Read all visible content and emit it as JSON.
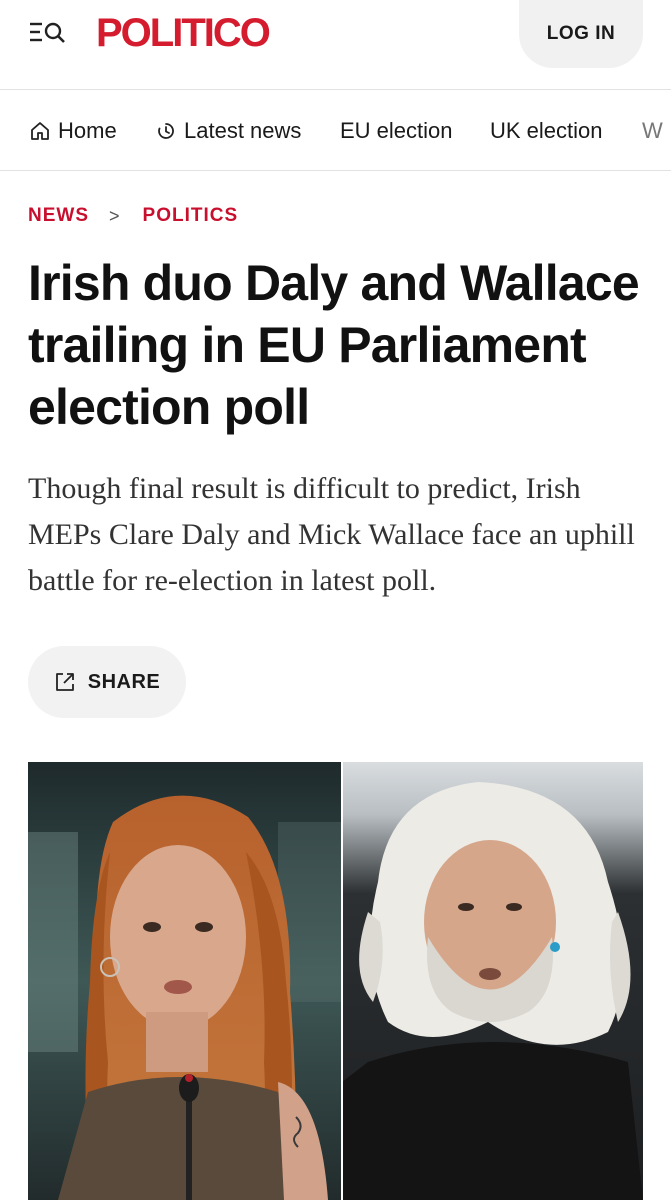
{
  "header": {
    "logo": "POLITICO",
    "login_label": "LOG IN",
    "menu_icon": "menu-search-icon",
    "brand_color": "#d41c2e"
  },
  "nav": {
    "items": [
      {
        "label": "Home",
        "icon": "home-icon"
      },
      {
        "label": "Latest news",
        "icon": "clock-icon"
      },
      {
        "label": "EU election"
      },
      {
        "label": "UK election"
      },
      {
        "label": "W"
      }
    ]
  },
  "breadcrumb": {
    "items": [
      "NEWS",
      "POLITICS"
    ],
    "separator": ">"
  },
  "article": {
    "headline": "Irish duo Daly and Wallace trailing in EU Parliament election poll",
    "dek": "Though final result is difficult to predict, Irish MEPs Clare Daly and Mick Wallace face an uphill battle for re-election in latest poll.",
    "share_label": "SHARE",
    "share_icon": "share-icon"
  },
  "colors": {
    "accent": "#c8102e",
    "text": "#111111",
    "button_bg": "#f2f2f2"
  }
}
